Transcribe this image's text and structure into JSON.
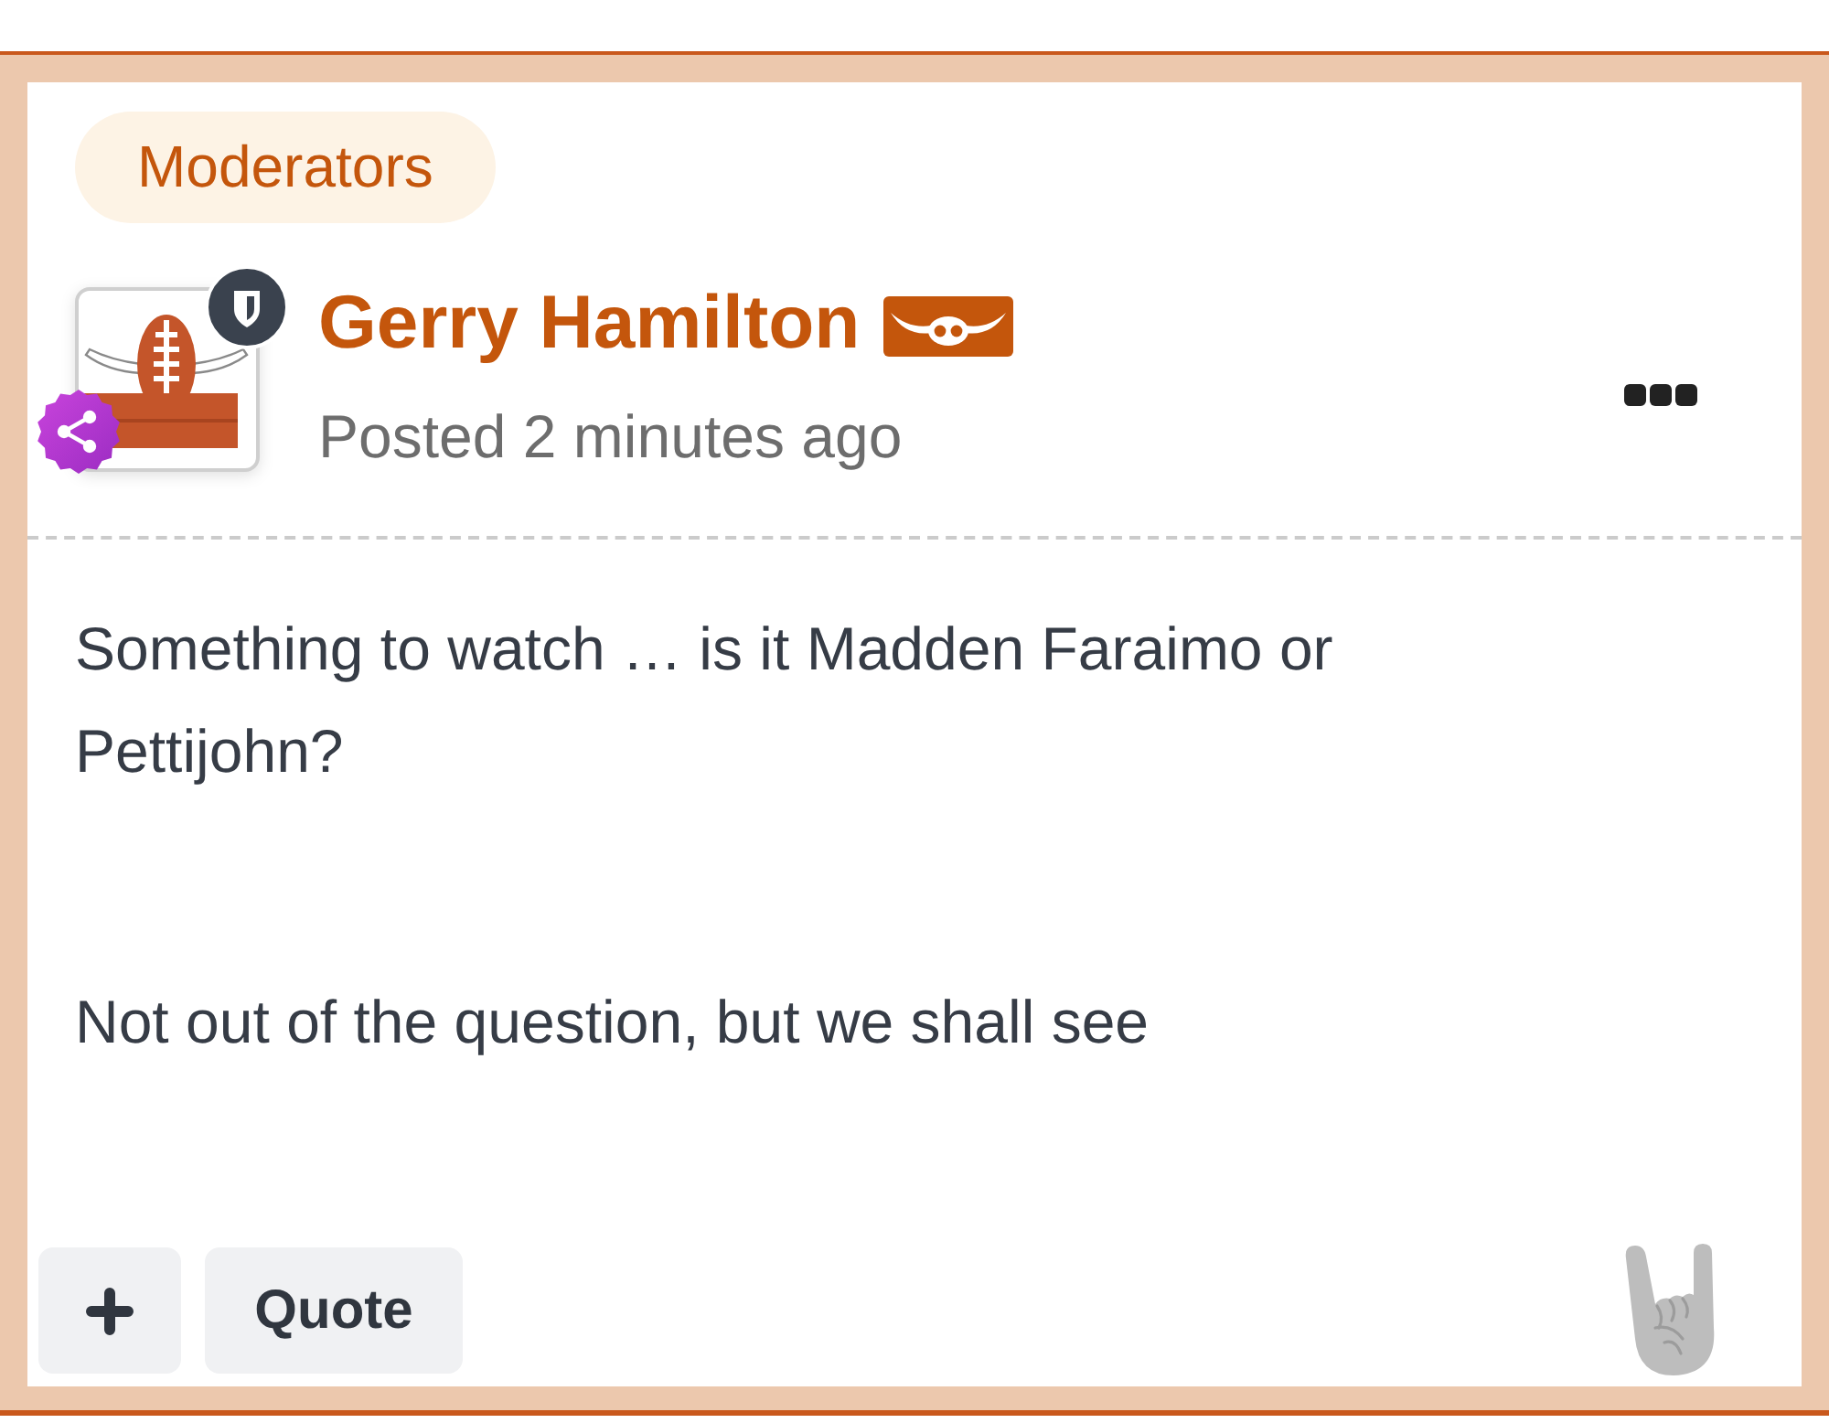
{
  "group": {
    "label": "Moderators"
  },
  "post": {
    "author_name": "Gerry Hamilton",
    "timestamp": "Posted 2 minutes ago",
    "paragraphs": [
      "Something to watch … is it Madden Faraimo or Pettijohn?",
      "Not out of the question, but we shall see"
    ]
  },
  "footer": {
    "quote_button": "Quote"
  }
}
